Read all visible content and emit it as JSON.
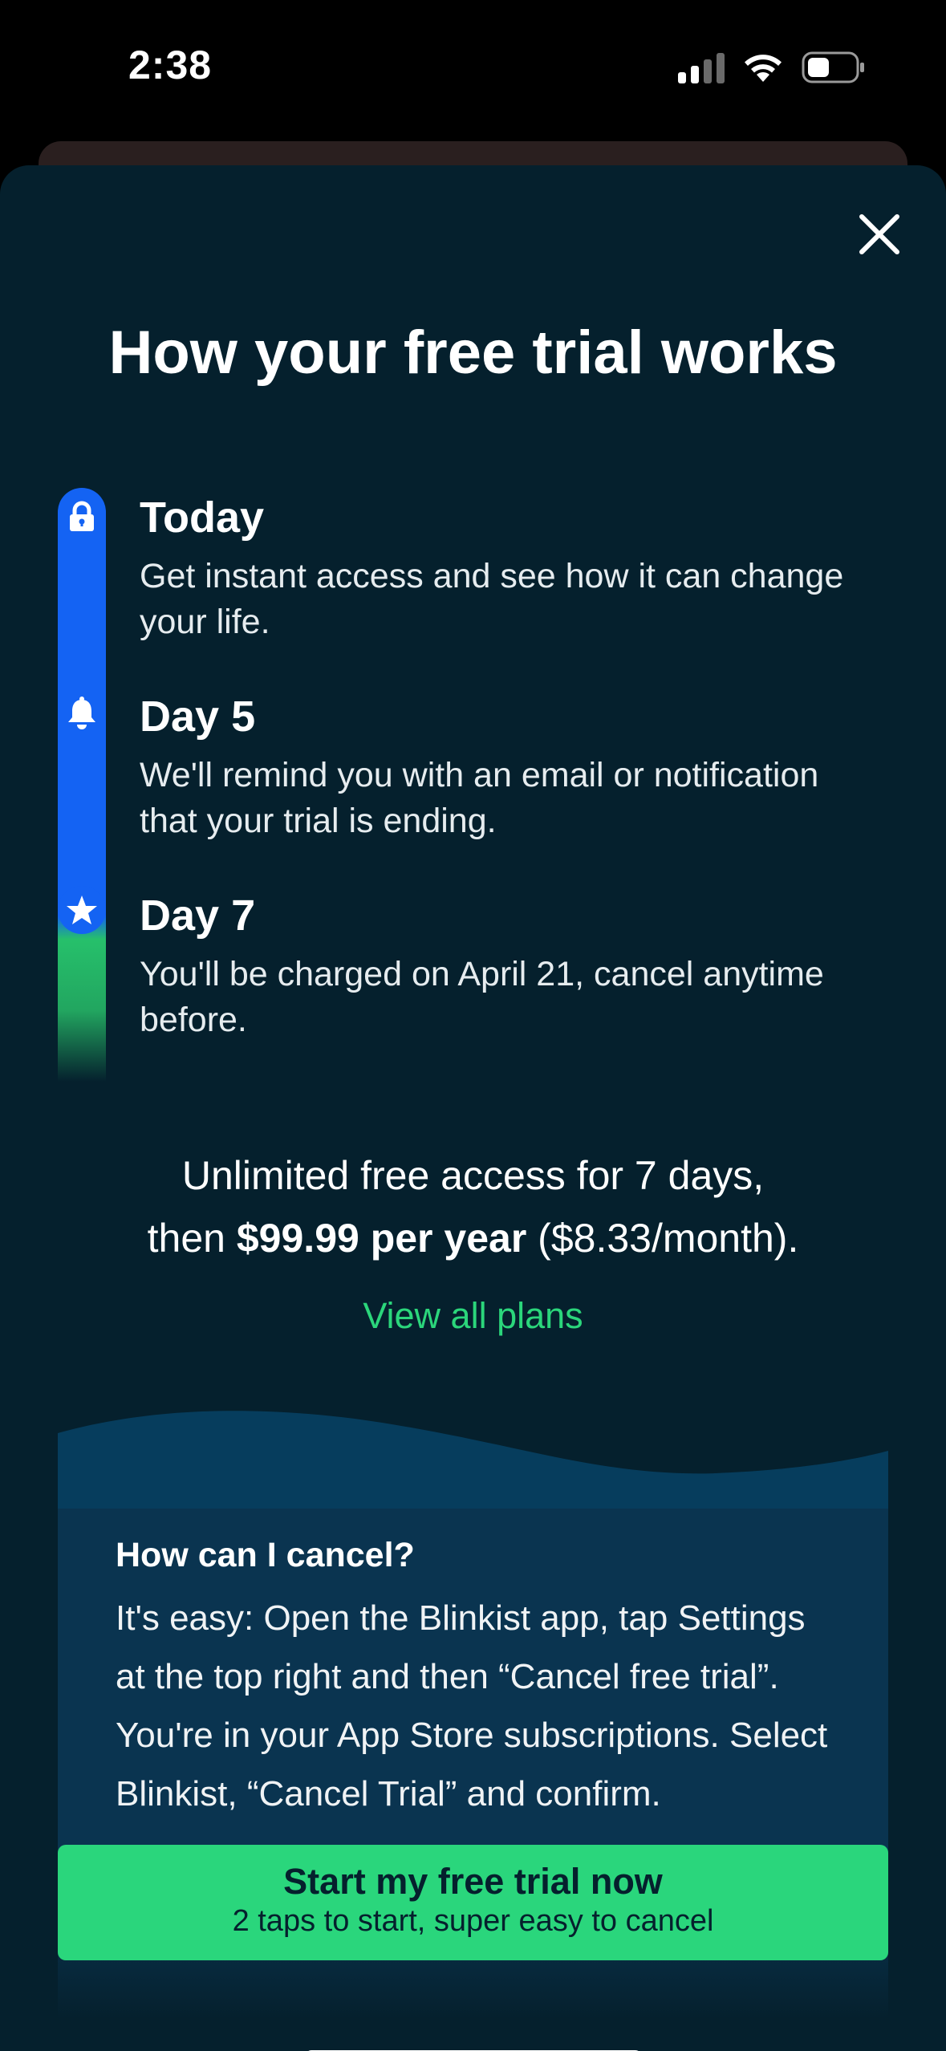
{
  "status_bar": {
    "time": "2:38",
    "icons": [
      "cellular-signal-icon",
      "wifi-icon",
      "battery-icon"
    ]
  },
  "sheet": {
    "close_icon": "close-icon",
    "title": "How your free trial works",
    "timeline": [
      {
        "icon": "lock-icon",
        "title": "Today",
        "description": "Get instant access and see how it can change your life."
      },
      {
        "icon": "bell-icon",
        "title": "Day 5",
        "description": "We'll remind you with an email or notification that your trial is ending."
      },
      {
        "icon": "star-icon",
        "title": "Day 7",
        "description": "You'll be charged on April 21, cancel anytime before."
      }
    ],
    "pricing": {
      "line1": "Unlimited free access for 7 days,",
      "line2_prefix": "then ",
      "line2_bold": "$99.99 per year",
      "line2_suffix": " ($8.33/month)."
    },
    "view_all_plans": "View all plans",
    "faq": {
      "title": "How can I cancel?",
      "text": "It's easy: Open the Blinkist app, tap Settings at the top right and then “Cancel free trial”. You're in your App Store subscriptions. Select Blinkist, “Cancel Trial” and confirm."
    },
    "cta": {
      "label": "Start my free trial now",
      "sublabel": "2 taps to start, super easy to cancel"
    }
  },
  "colors": {
    "background": "#05202d",
    "timeline_blue": "#1463f3",
    "accent_green": "#2ad67c",
    "faq_panel": "#0a3450"
  }
}
